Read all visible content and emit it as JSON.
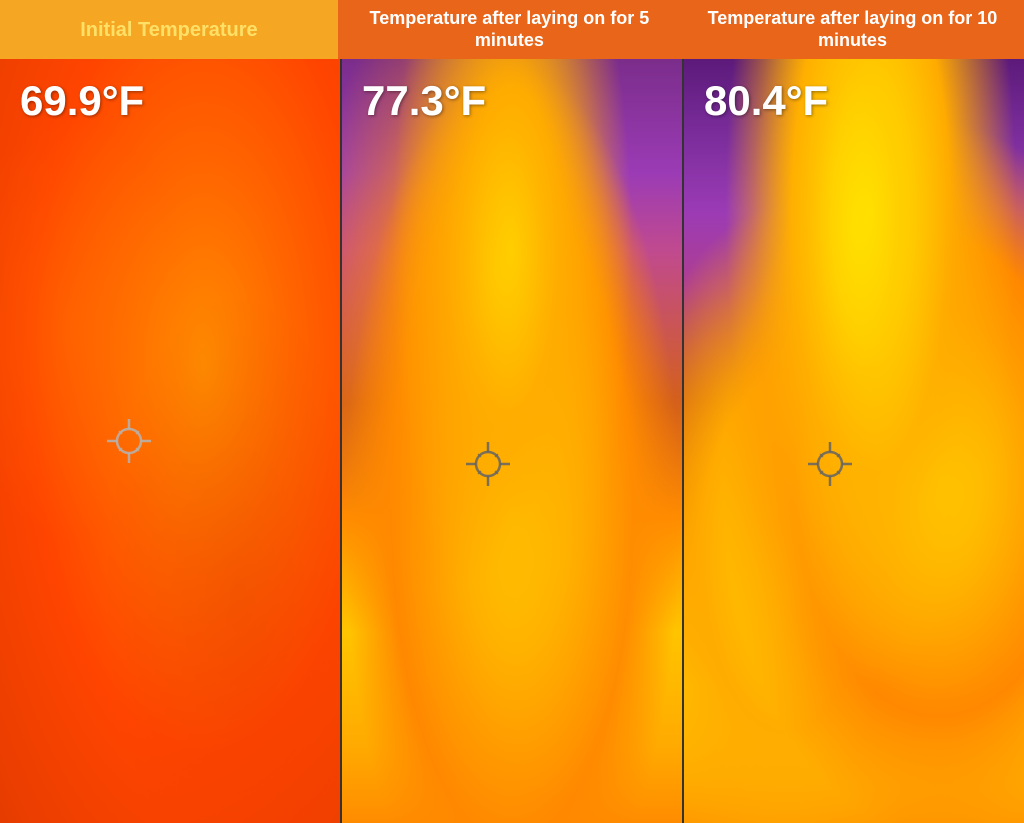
{
  "header": {
    "col1": {
      "label": "Initial Temperature",
      "bg": "#f5a623"
    },
    "col2": {
      "label": "Temperature after laying on for 5 minutes",
      "bg": "#e8651a"
    },
    "col3": {
      "label": "Temperature after laying on for 10 minutes",
      "bg": "#e8651a"
    }
  },
  "panels": {
    "initial": {
      "temperature": "69.9°F"
    },
    "five_min": {
      "temperature": "77.3°F"
    },
    "ten_min": {
      "temperature": "80.4°F"
    }
  }
}
